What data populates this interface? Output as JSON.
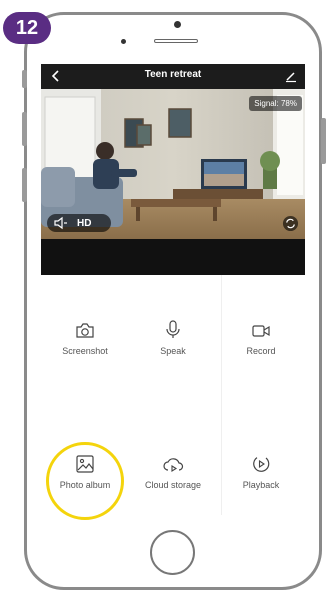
{
  "step_badge": "12",
  "header": {
    "title": "Teen retreat",
    "back_icon": "chevron-left-icon",
    "edit_icon": "pencil-icon"
  },
  "video": {
    "watermark": "",
    "signal_label": "Signal: 78%",
    "quality_label": "HD",
    "mute_icon": "speaker-icon",
    "rotate_icon": "rotate-icon"
  },
  "actions": [
    {
      "label": "Screenshot",
      "icon": "camera-icon"
    },
    {
      "label": "Speak",
      "icon": "microphone-icon"
    },
    {
      "label": "Record",
      "icon": "video-record-icon"
    },
    {
      "label": "Photo album",
      "icon": "image-icon"
    },
    {
      "label": "Cloud storage",
      "icon": "cloud-play-icon"
    },
    {
      "label": "Playback",
      "icon": "playback-icon"
    }
  ],
  "colors": {
    "badge": "#5a2d83",
    "highlight": "#f4d40c",
    "header": "#1c1c1c"
  }
}
